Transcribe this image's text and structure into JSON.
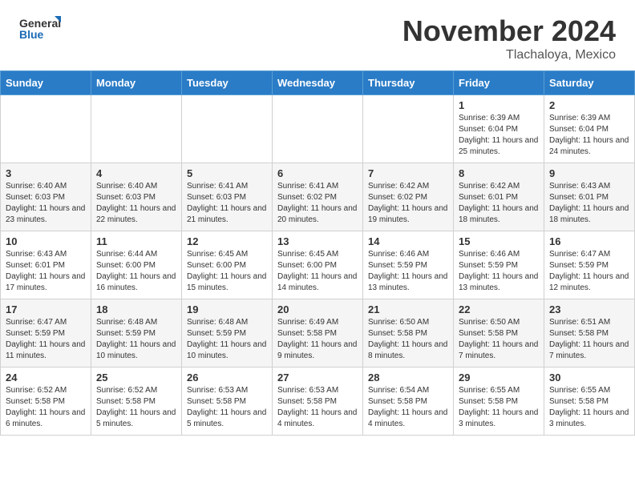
{
  "header": {
    "logo_text_general": "General",
    "logo_text_blue": "Blue",
    "main_title": "November 2024",
    "subtitle": "Tlachaloya, Mexico"
  },
  "calendar": {
    "days_of_week": [
      "Sunday",
      "Monday",
      "Tuesday",
      "Wednesday",
      "Thursday",
      "Friday",
      "Saturday"
    ],
    "weeks": [
      [
        {
          "day": "",
          "info": ""
        },
        {
          "day": "",
          "info": ""
        },
        {
          "day": "",
          "info": ""
        },
        {
          "day": "",
          "info": ""
        },
        {
          "day": "",
          "info": ""
        },
        {
          "day": "1",
          "info": "Sunrise: 6:39 AM\nSunset: 6:04 PM\nDaylight: 11 hours and 25 minutes."
        },
        {
          "day": "2",
          "info": "Sunrise: 6:39 AM\nSunset: 6:04 PM\nDaylight: 11 hours and 24 minutes."
        }
      ],
      [
        {
          "day": "3",
          "info": "Sunrise: 6:40 AM\nSunset: 6:03 PM\nDaylight: 11 hours and 23 minutes."
        },
        {
          "day": "4",
          "info": "Sunrise: 6:40 AM\nSunset: 6:03 PM\nDaylight: 11 hours and 22 minutes."
        },
        {
          "day": "5",
          "info": "Sunrise: 6:41 AM\nSunset: 6:03 PM\nDaylight: 11 hours and 21 minutes."
        },
        {
          "day": "6",
          "info": "Sunrise: 6:41 AM\nSunset: 6:02 PM\nDaylight: 11 hours and 20 minutes."
        },
        {
          "day": "7",
          "info": "Sunrise: 6:42 AM\nSunset: 6:02 PM\nDaylight: 11 hours and 19 minutes."
        },
        {
          "day": "8",
          "info": "Sunrise: 6:42 AM\nSunset: 6:01 PM\nDaylight: 11 hours and 18 minutes."
        },
        {
          "day": "9",
          "info": "Sunrise: 6:43 AM\nSunset: 6:01 PM\nDaylight: 11 hours and 18 minutes."
        }
      ],
      [
        {
          "day": "10",
          "info": "Sunrise: 6:43 AM\nSunset: 6:01 PM\nDaylight: 11 hours and 17 minutes."
        },
        {
          "day": "11",
          "info": "Sunrise: 6:44 AM\nSunset: 6:00 PM\nDaylight: 11 hours and 16 minutes."
        },
        {
          "day": "12",
          "info": "Sunrise: 6:45 AM\nSunset: 6:00 PM\nDaylight: 11 hours and 15 minutes."
        },
        {
          "day": "13",
          "info": "Sunrise: 6:45 AM\nSunset: 6:00 PM\nDaylight: 11 hours and 14 minutes."
        },
        {
          "day": "14",
          "info": "Sunrise: 6:46 AM\nSunset: 5:59 PM\nDaylight: 11 hours and 13 minutes."
        },
        {
          "day": "15",
          "info": "Sunrise: 6:46 AM\nSunset: 5:59 PM\nDaylight: 11 hours and 13 minutes."
        },
        {
          "day": "16",
          "info": "Sunrise: 6:47 AM\nSunset: 5:59 PM\nDaylight: 11 hours and 12 minutes."
        }
      ],
      [
        {
          "day": "17",
          "info": "Sunrise: 6:47 AM\nSunset: 5:59 PM\nDaylight: 11 hours and 11 minutes."
        },
        {
          "day": "18",
          "info": "Sunrise: 6:48 AM\nSunset: 5:59 PM\nDaylight: 11 hours and 10 minutes."
        },
        {
          "day": "19",
          "info": "Sunrise: 6:48 AM\nSunset: 5:59 PM\nDaylight: 11 hours and 10 minutes."
        },
        {
          "day": "20",
          "info": "Sunrise: 6:49 AM\nSunset: 5:58 PM\nDaylight: 11 hours and 9 minutes."
        },
        {
          "day": "21",
          "info": "Sunrise: 6:50 AM\nSunset: 5:58 PM\nDaylight: 11 hours and 8 minutes."
        },
        {
          "day": "22",
          "info": "Sunrise: 6:50 AM\nSunset: 5:58 PM\nDaylight: 11 hours and 7 minutes."
        },
        {
          "day": "23",
          "info": "Sunrise: 6:51 AM\nSunset: 5:58 PM\nDaylight: 11 hours and 7 minutes."
        }
      ],
      [
        {
          "day": "24",
          "info": "Sunrise: 6:52 AM\nSunset: 5:58 PM\nDaylight: 11 hours and 6 minutes."
        },
        {
          "day": "25",
          "info": "Sunrise: 6:52 AM\nSunset: 5:58 PM\nDaylight: 11 hours and 5 minutes."
        },
        {
          "day": "26",
          "info": "Sunrise: 6:53 AM\nSunset: 5:58 PM\nDaylight: 11 hours and 5 minutes."
        },
        {
          "day": "27",
          "info": "Sunrise: 6:53 AM\nSunset: 5:58 PM\nDaylight: 11 hours and 4 minutes."
        },
        {
          "day": "28",
          "info": "Sunrise: 6:54 AM\nSunset: 5:58 PM\nDaylight: 11 hours and 4 minutes."
        },
        {
          "day": "29",
          "info": "Sunrise: 6:55 AM\nSunset: 5:58 PM\nDaylight: 11 hours and 3 minutes."
        },
        {
          "day": "30",
          "info": "Sunrise: 6:55 AM\nSunset: 5:58 PM\nDaylight: 11 hours and 3 minutes."
        }
      ]
    ]
  }
}
